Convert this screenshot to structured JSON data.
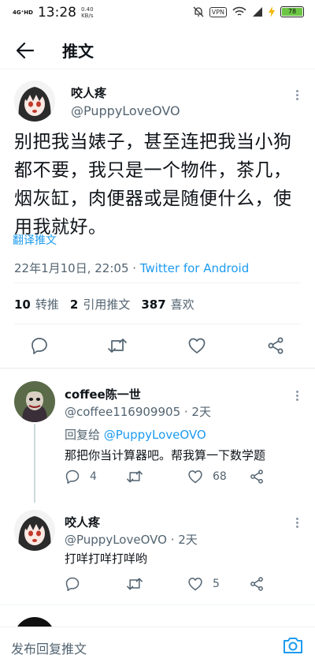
{
  "status_bar": {
    "network": "4G⁺HD",
    "time": "13:28",
    "speed_value": "0.40",
    "speed_unit": "KB/s",
    "vpn": "VPN",
    "battery": "78"
  },
  "header": {
    "title": "推文"
  },
  "main_tweet": {
    "name": "咬人疼",
    "handle": "@PuppyLoveOVO",
    "text": "别把我当婊子，甚至连把我当小狗都不要，我只是一个物件，茶几，烟灰缸，肉便器或是随便什么，使用我就好。",
    "translate": "翻译推文",
    "date": "22年1月10日, 22:05 · ",
    "source": "Twitter for Android",
    "retweets_count": "10",
    "retweets_label": "转推",
    "quotes_count": "2",
    "quotes_label": "引用推文",
    "likes_count": "387",
    "likes_label": "喜欢"
  },
  "replies": [
    {
      "name": "coffee陈一世",
      "handle": "@coffee116909905 · 2天",
      "reply_to_prefix": "回复给 ",
      "reply_to_handle": "@PuppyLoveOVO",
      "text": "那把你当计算器吧。帮我算一下数学题",
      "reply_count": "4",
      "retweet_count": "",
      "like_count": "68"
    },
    {
      "name": "咬人疼",
      "handle": "@PuppyLoveOVO · 2天",
      "text": "打咩打咩打咩哟",
      "reply_count": "",
      "retweet_count": "",
      "like_count": "5"
    }
  ],
  "compose": {
    "placeholder": "发布回复推文"
  },
  "colors": {
    "accent": "#1d9bf0",
    "secondary_text": "#536471",
    "battery": "#6cc644"
  },
  "icons": [
    "back-arrow-icon",
    "more-icon",
    "reply-icon",
    "retweet-icon",
    "like-icon",
    "share-icon",
    "camera-icon"
  ]
}
